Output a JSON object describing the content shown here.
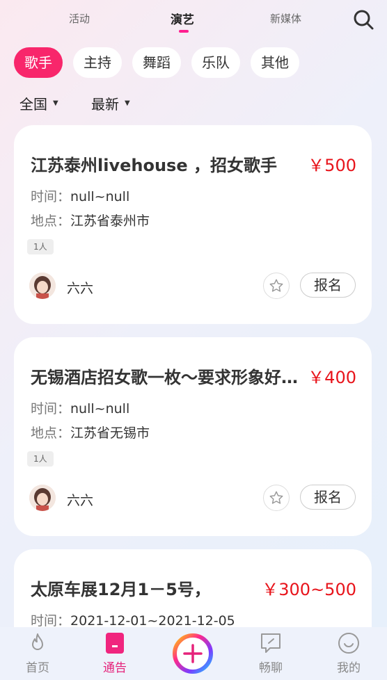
{
  "top_tabs": [
    {
      "label": "活动"
    },
    {
      "label": "演艺"
    },
    {
      "label": "新媒体"
    }
  ],
  "categories": [
    {
      "label": "歌手"
    },
    {
      "label": "主持"
    },
    {
      "label": "舞蹈"
    },
    {
      "label": "乐队"
    },
    {
      "label": "其他"
    }
  ],
  "filters": {
    "region": "全国",
    "sort": "最新"
  },
  "labels": {
    "time": "时间：",
    "location": "地点：",
    "apply": "报名"
  },
  "posts": [
    {
      "title": "江苏泰州livehouse ，招女歌手",
      "price": "￥500",
      "time": "null~null",
      "location": "江苏省泰州市",
      "tag": "1人",
      "user": "六六"
    },
    {
      "title": "无锡酒店招女歌一枚～要求形象好，气质佳",
      "price": "￥400",
      "time": "null~null",
      "location": "江苏省无锡市",
      "tag": "1人",
      "user": "六六"
    },
    {
      "title": "太原车展12月1－5号，",
      "price": "￥300~500",
      "time": "2021-12-01~2021-12-05"
    }
  ],
  "bottom_nav": [
    {
      "label": "首页",
      "icon": "flame-icon"
    },
    {
      "label": "通告",
      "icon": "notice-icon"
    },
    {
      "label": "畅聊",
      "icon": "chat-icon"
    },
    {
      "label": "我的",
      "icon": "profile-icon"
    }
  ],
  "colors": {
    "accent": "#f8266b",
    "price": "#e8141b",
    "nav_active": "#e5227a"
  }
}
